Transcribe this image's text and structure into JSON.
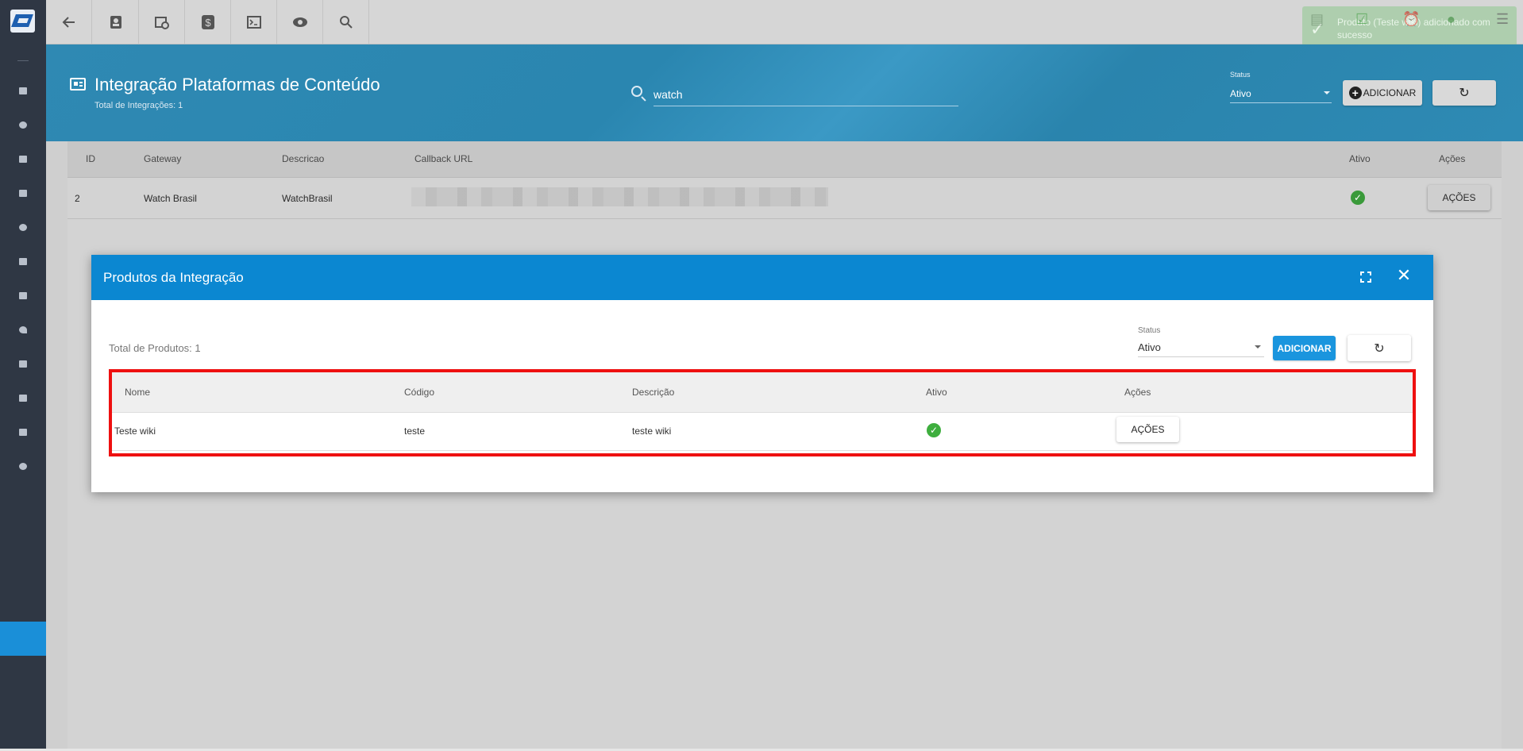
{
  "toolbar": {
    "buttons": [
      "back",
      "contacts",
      "schedule",
      "billing",
      "terminal",
      "view",
      "search"
    ]
  },
  "notification": {
    "text": "Produto (Teste wiki) adicionado com sucesso"
  },
  "header": {
    "title": "Integração Plataformas de Conteúdo",
    "subtitle": "Total de Integrações: 1",
    "search_value": "watch",
    "status_label": "Status",
    "status_value": "Ativo",
    "add_label": "ADICIONAR"
  },
  "main_table": {
    "columns": [
      "ID",
      "Gateway",
      "Descricao",
      "Callback URL",
      "Ativo",
      "Ações"
    ],
    "rows": [
      {
        "id": "2",
        "gateway": "Watch Brasil",
        "descricao": "WatchBrasil",
        "acoes": "AÇÕES"
      }
    ]
  },
  "modal": {
    "title": "Produtos da Integração",
    "total": "Total de Produtos: 1",
    "status_label": "Status",
    "status_value": "Ativo",
    "add_label": "ADICIONAR",
    "columns": [
      "Nome",
      "Código",
      "Descrição",
      "Ativo",
      "Ações"
    ],
    "rows": [
      {
        "nome": "Teste wiki",
        "codigo": "teste",
        "descricao": "teste wiki",
        "acoes": "AÇÕES"
      }
    ]
  },
  "colors": {
    "primary": "#0b87d1",
    "sidebar": "#2f3744",
    "highlight": "#ee1010",
    "success": "#3eae3e"
  }
}
